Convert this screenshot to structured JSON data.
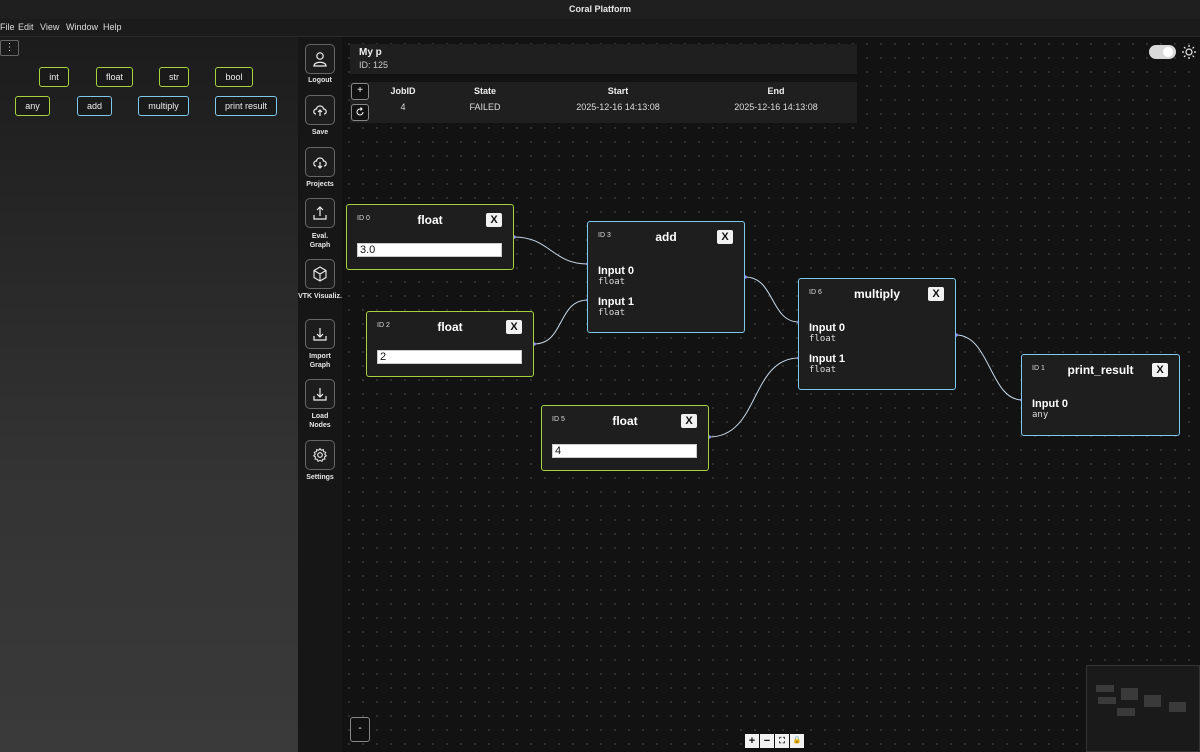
{
  "window": {
    "title": "Coral Platform"
  },
  "menu": [
    "File",
    "Edit",
    "View",
    "Window",
    "Help"
  ],
  "palette": {
    "kebab": "⋮",
    "row1": [
      "int",
      "float",
      "str",
      "bool"
    ],
    "row2": [
      "any",
      "add",
      "multiply",
      "print result"
    ]
  },
  "sidebar": {
    "logout": "Logout",
    "save": "Save",
    "projects": "Projects",
    "eval_graph": "Eval. Graph",
    "vtk": "VTK Visualiz.",
    "import_graph": "Import Graph",
    "load_nodes": "Load Nodes",
    "settings": "Settings"
  },
  "project": {
    "name": "My p",
    "id_label": "ID: 125"
  },
  "jobs": {
    "add_btn": "+",
    "headers": [
      "JobID",
      "State",
      "Start",
      "End"
    ],
    "rows": [
      [
        "4",
        "FAILED",
        "2025-12-16 14:13:08",
        "2025-12-16 14:13:08"
      ]
    ]
  },
  "nodes": {
    "n0": {
      "id": "ID 0",
      "title": "float",
      "close": "X",
      "value": "3.0"
    },
    "n2": {
      "id": "ID 2",
      "title": "float",
      "close": "X",
      "value": "2"
    },
    "n5": {
      "id": "ID 5",
      "title": "float",
      "close": "X",
      "value": "4"
    },
    "n3": {
      "id": "ID 3",
      "title": "add",
      "close": "X",
      "in0": "Input 0",
      "in0_type": "float",
      "in1": "Input 1",
      "in1_type": "float"
    },
    "n6": {
      "id": "ID 6",
      "title": "multiply",
      "close": "X",
      "in0": "Input 0",
      "in0_type": "float",
      "in1": "Input 1",
      "in1_type": "float"
    },
    "n1": {
      "id": "ID 1",
      "title": "print_result",
      "close": "X",
      "in0": "Input 0",
      "in0_type": "any"
    }
  },
  "controls": {
    "minus": "-",
    "zoom_in": "+",
    "zoom_out": "−",
    "fit": "⛶",
    "lock": "🔒"
  },
  "colors": {
    "number_node_border": "#a6d23c",
    "op_node_border": "#7ec8ee",
    "edge": "#c8d8e8"
  }
}
